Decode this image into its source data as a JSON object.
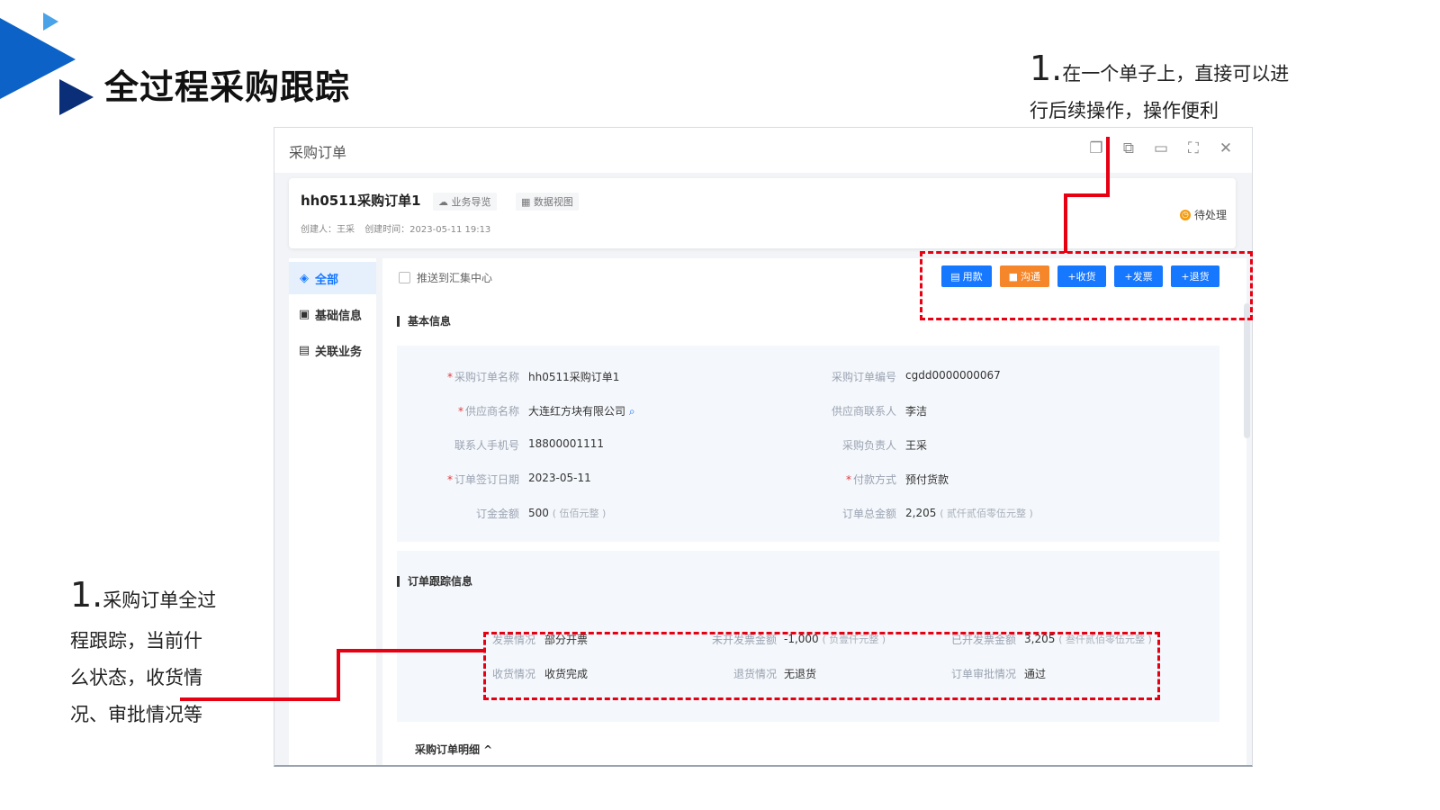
{
  "slide": {
    "title": "全过程采购跟踪",
    "callout_top": {
      "num": "1.",
      "text1": "在一个单子上，直接可以进",
      "text2": "行后续操作，操作便利"
    },
    "callout_left": {
      "num": "1.",
      "text1": "采购订单全过",
      "text2": "程跟踪，当前什",
      "text3": "么状态，收货情",
      "text4": "况、审批情况等"
    },
    "annotation_color": "#e60012"
  },
  "window": {
    "title": "采购订单",
    "controls": [
      "copy-icon",
      "duplicate-icon",
      "device-icon",
      "fullscreen-icon",
      "close-icon"
    ]
  },
  "order": {
    "name": "hh0511采购订单1",
    "chips": [
      "业务导览",
      "数据视图"
    ],
    "creator": "创建人：王采",
    "created_time": "创建时间：2023-05-11 19:13",
    "status": "待处理"
  },
  "sidebar": {
    "items": [
      {
        "label": "全部",
        "active": true
      },
      {
        "label": "基础信息",
        "active": false
      },
      {
        "label": "关联业务",
        "active": false
      }
    ]
  },
  "toolbar": {
    "push_label": "推送到汇集中心",
    "buttons": [
      {
        "label": "用款",
        "color": "#1677ff"
      },
      {
        "label": "沟通",
        "color": "#f5862a"
      },
      {
        "label": "+收货",
        "color": "#1677ff"
      },
      {
        "label": "+发票",
        "color": "#1677ff"
      },
      {
        "label": "+退货",
        "color": "#1677ff"
      }
    ]
  },
  "basic_info": {
    "title": "基本信息",
    "fields": [
      {
        "label": "采购订单名称",
        "value": "hh0511采购订单1",
        "required": true
      },
      {
        "label": "采购订单编号",
        "value": "cgdd0000000067",
        "required": false
      },
      {
        "label": "供应商名称",
        "value": "大连红方块有限公司",
        "required": true
      },
      {
        "label": "供应商联系人",
        "value": "李洁",
        "required": false
      },
      {
        "label": "联系人手机号",
        "value": "18800001111",
        "required": false
      },
      {
        "label": "采购负责人",
        "value": "王采",
        "required": false
      },
      {
        "label": "订单签订日期",
        "value": "2023-05-11",
        "required": true
      },
      {
        "label": "付款方式",
        "value": "预付货款",
        "required": true
      },
      {
        "label": "订金金额",
        "value": "500",
        "sub": "( 伍佰元整 )",
        "required": false
      },
      {
        "label": "订单总金额",
        "value": "2,205",
        "sub": "( 贰仟贰佰零伍元整 )",
        "required": false
      }
    ]
  },
  "tracking": {
    "title": "订单跟踪信息",
    "fields": [
      {
        "label": "发票情况",
        "value": "部分开票"
      },
      {
        "label": "未开发票金额",
        "value": "-1,000",
        "sub": "( 负壹仟元整 )"
      },
      {
        "label": "已开发票金额",
        "value": "3,205",
        "sub": "( 叁仟贰佰零伍元整 )"
      },
      {
        "label": "收货情况",
        "value": "收货完成"
      },
      {
        "label": "退货情况",
        "value": "无退货"
      },
      {
        "label": "订单审批情况",
        "value": "通过"
      }
    ]
  },
  "detail": {
    "title": "采购订单明细 ^"
  }
}
